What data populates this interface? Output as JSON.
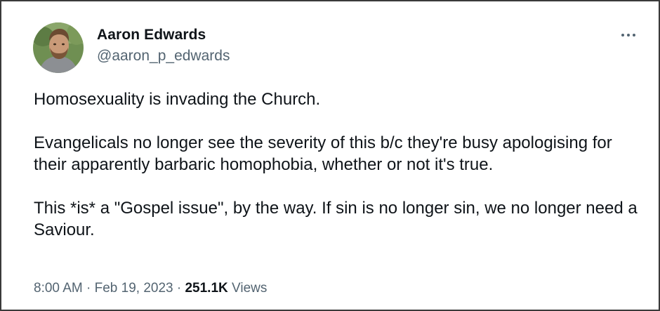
{
  "author": {
    "name": "Aaron Edwards",
    "handle": "@aaron_p_edwards",
    "avatar_icon": "profile-photo"
  },
  "more_icon": "more-horizontal-icon",
  "tweet": {
    "paragraphs": [
      "Homosexuality is invading the Church.",
      "Evangelicals no longer see the severity of this b/c they're busy apologising for their apparently barbaric homophobia, whether or not it's true.",
      "This *is* a \"Gospel issue\", by the way. If sin is no longer sin, we no longer need a Saviour."
    ]
  },
  "meta": {
    "time": "8:00 AM",
    "separator": "·",
    "date": "Feb 19, 2023",
    "views_count": "251.1K",
    "views_label": "Views"
  },
  "colors": {
    "text_primary": "#0f1419",
    "text_secondary": "#536471",
    "border": "#3a3a3a"
  }
}
